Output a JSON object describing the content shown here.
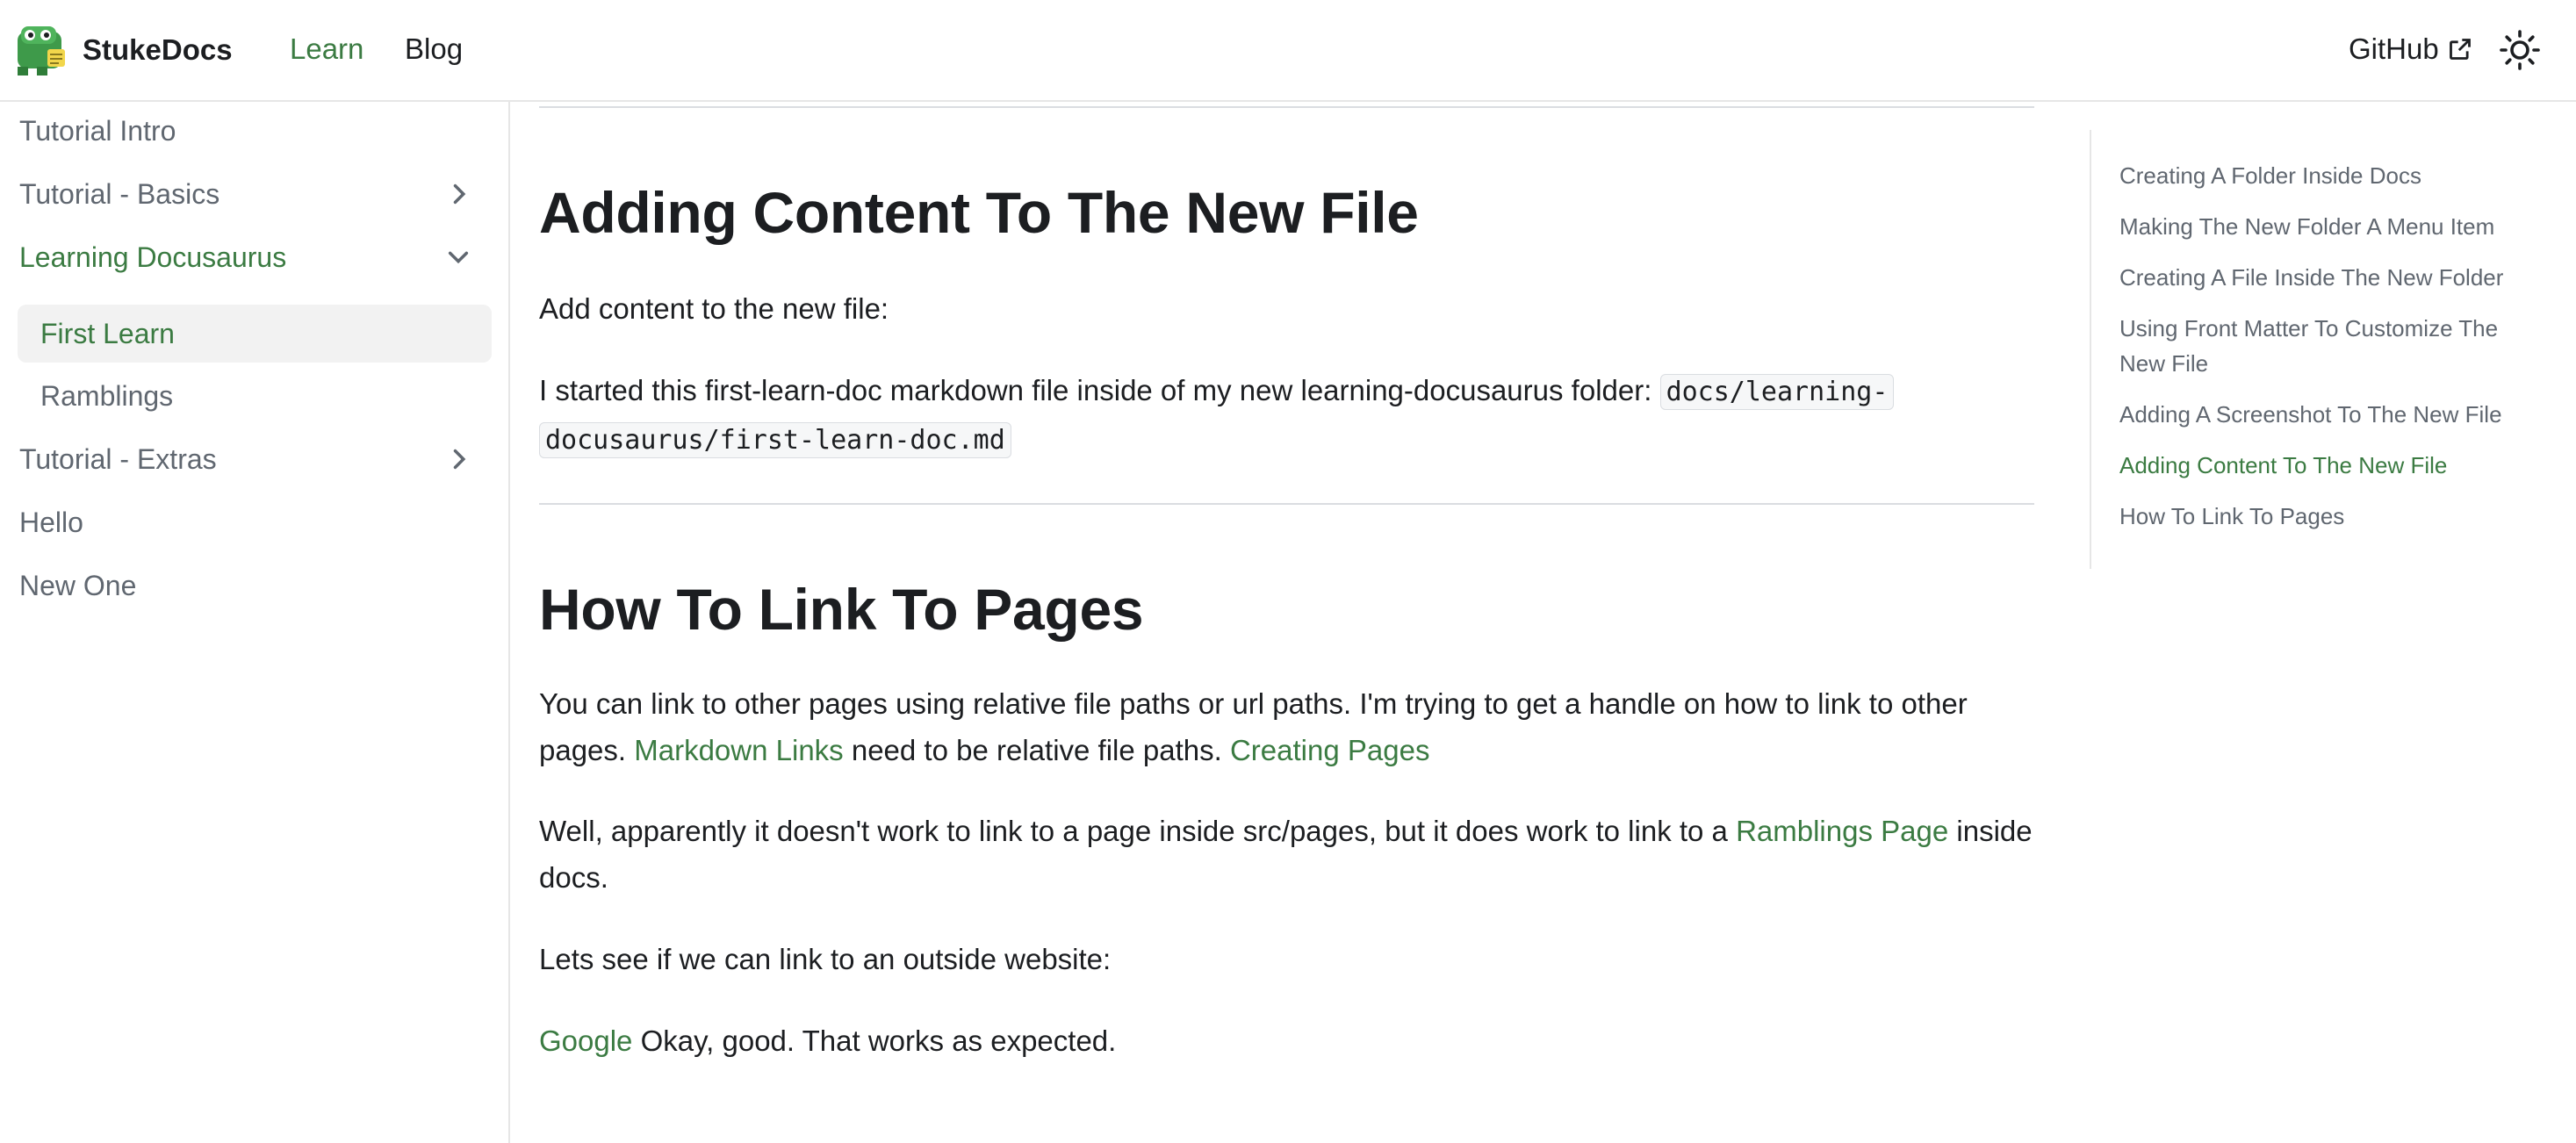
{
  "navbar": {
    "brand_title": "StukeDocs",
    "links": [
      {
        "label": "Learn",
        "active": true
      },
      {
        "label": "Blog",
        "active": false
      }
    ],
    "github_label": "GitHub",
    "accent_color": "#3b7b42"
  },
  "sidebar": {
    "items": [
      {
        "label": "Tutorial Intro"
      },
      {
        "label": "Tutorial - Basics",
        "icon": "chevron-right-icon"
      },
      {
        "label": "Learning Docusaurus",
        "icon": "chevron-down-icon",
        "expanded": true
      },
      {
        "label": "First Learn",
        "current": true
      },
      {
        "label": "Ramblings"
      },
      {
        "label": "Tutorial - Extras",
        "icon": "chevron-right-icon"
      },
      {
        "label": "Hello"
      },
      {
        "label": "New One"
      }
    ]
  },
  "main": {
    "section1": {
      "heading": "Adding Content To The New File",
      "p1": "Add content to the new file:",
      "p2_text": "I started this first-learn-doc markdown file inside of my new learning-docusaurus folder: ",
      "p2_code_line1": "docs/learning-",
      "p2_code_line2": "docusaurus/first-learn-doc.md"
    },
    "section2": {
      "heading": "How To Link To Pages",
      "p1_a": "You can link to other pages using relative file paths or url paths. I'm trying to get a handle on how to link to other",
      "p1_b": "pages. ",
      "p1_link1": "Markdown Links",
      "p1_c": " need to be relative file paths. ",
      "p1_link2": "Creating Pages",
      "p2_a": "Well, apparently it doesn't work to link to a page inside src/pages, but it does work to link to a ",
      "p2_link": "Ramblings Page",
      "p2_b": " inside",
      "p2_c": "docs.",
      "p3": "Lets see if we can link to an outside website:",
      "p4_link": "Google",
      "p4_text": " Okay, good. That works as expected."
    }
  },
  "toc": {
    "items": [
      {
        "label": "Creating A Folder Inside Docs"
      },
      {
        "label": "Making The New Folder A Menu Item"
      },
      {
        "label": "Creating A File Inside The New Folder"
      },
      {
        "label": "Using Front Matter To Customize The New File"
      },
      {
        "label": "Adding A Screenshot To The New File"
      },
      {
        "label": "Adding Content To The New File",
        "active": true
      },
      {
        "label": "How To Link To Pages"
      }
    ]
  }
}
